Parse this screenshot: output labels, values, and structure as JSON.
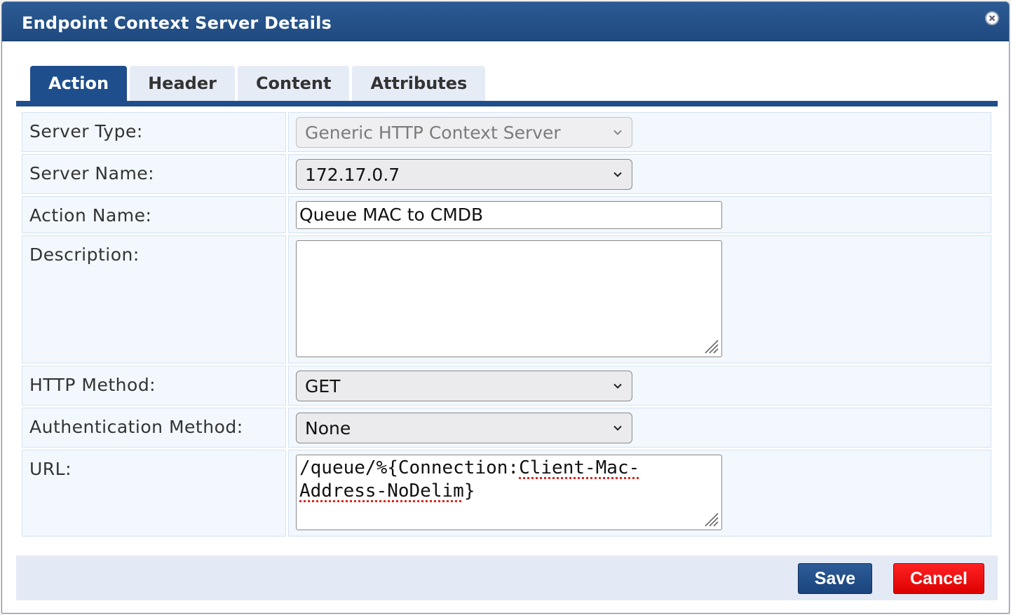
{
  "dialog": {
    "title": "Endpoint Context Server Details",
    "close_icon": "close-circle-icon"
  },
  "tabs": [
    {
      "label": "Action",
      "active": true
    },
    {
      "label": "Header",
      "active": false
    },
    {
      "label": "Content",
      "active": false
    },
    {
      "label": "Attributes",
      "active": false
    }
  ],
  "form": {
    "server_type": {
      "label": "Server Type:",
      "value": "Generic HTTP Context Server",
      "disabled": true
    },
    "server_name": {
      "label": "Server Name:",
      "value": "172.17.0.7"
    },
    "action_name": {
      "label": "Action Name:",
      "value": "Queue MAC to CMDB"
    },
    "description": {
      "label": "Description:",
      "value": ""
    },
    "http_method": {
      "label": "HTTP Method:",
      "value": "GET"
    },
    "auth_method": {
      "label": "Authentication Method:",
      "value": "None"
    },
    "url": {
      "label": "URL:",
      "value_part1": "/queue/%{Connection:",
      "value_part2": "Client-Mac-",
      "value_part3": "Address-NoDelim",
      "value_part4": "}"
    }
  },
  "buttons": {
    "save": "Save",
    "cancel": "Cancel"
  },
  "colors": {
    "titlebar": "#1f4a80",
    "active_tab": "#1f4e8c",
    "cancel": "#e00000"
  }
}
